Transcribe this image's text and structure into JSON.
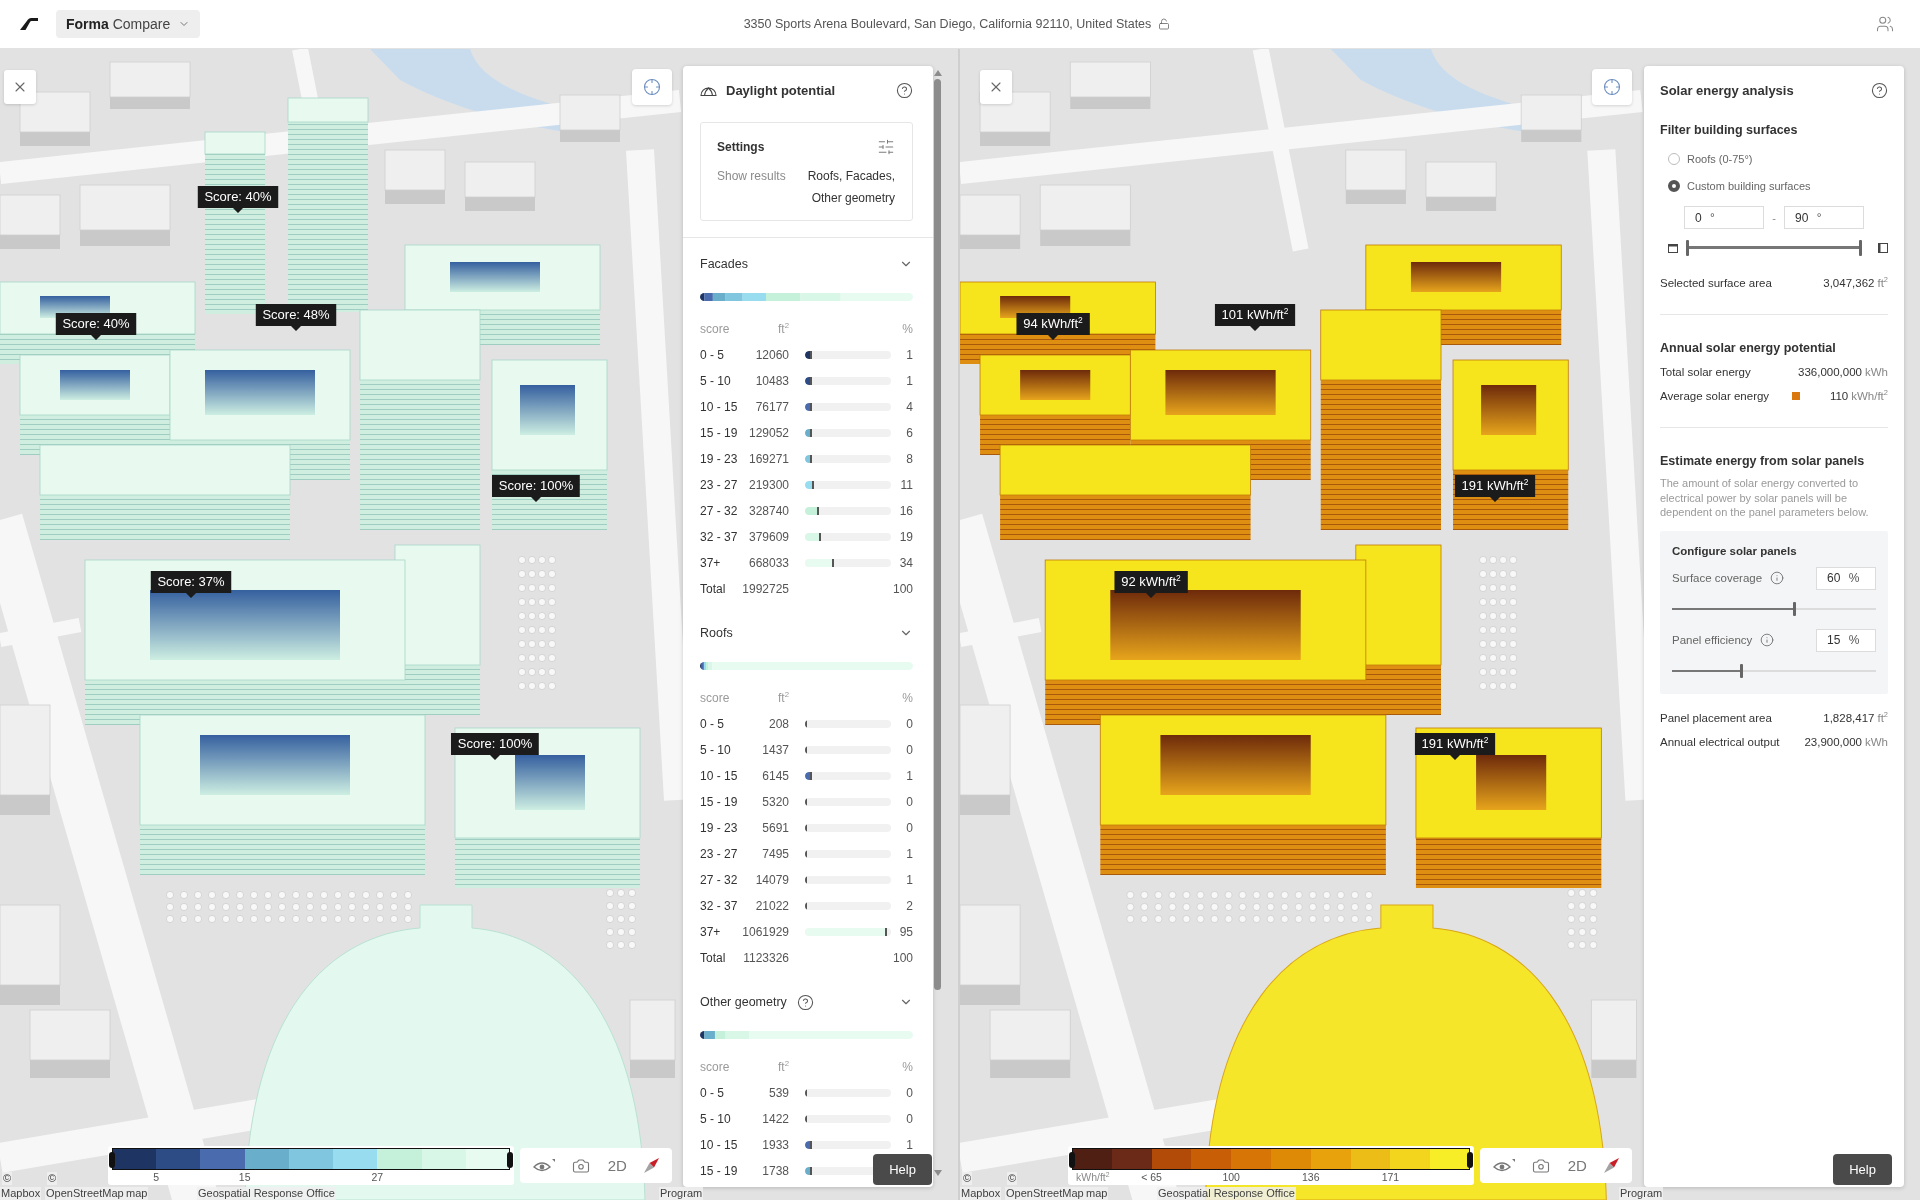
{
  "top_bar": {
    "app_switcher": "**Forma** Compare",
    "address": "3350 Sports Arena Boulevard, San Diego, California 92110, United States"
  },
  "views": [
    {
      "kind": "daylight",
      "map_labels": [
        "Score: 40%",
        "Score: 40%",
        "Score: 48%",
        "Score: 100%",
        "Score: 37%",
        "Score: 100%"
      ],
      "panel": {
        "title": "Daylight potential",
        "settings": {
          "title": "Settings",
          "label": "Show results",
          "value": "Roofs, Facades, Other geometry"
        },
        "sections": [
          {
            "title": "Facades",
            "expanded": true,
            "info_icon": false,
            "columns": [
              "score",
              "ft$^{2}$",
              "%"
            ],
            "rows": [
              {
                "score": "0 - 5",
                "area": "12060",
                "percent": "1",
                "level": 0.01,
                "color": "#1e3563"
              },
              {
                "score": "5 - 10",
                "area": "10483",
                "percent": "1",
                "level": 0.01,
                "color": "#2d4c86"
              },
              {
                "score": "10 - 15",
                "area": "76177",
                "percent": "4",
                "level": 0.04,
                "color": "#4a6cae"
              },
              {
                "score": "15 - 19",
                "area": "129052",
                "percent": "6",
                "level": 0.06,
                "color": "#69aecb"
              },
              {
                "score": "19 - 23",
                "area": "169271",
                "percent": "8",
                "level": 0.08,
                "color": "#7fc6de"
              },
              {
                "score": "23 - 27",
                "area": "219300",
                "percent": "11",
                "level": 0.11,
                "color": "#97dcef"
              },
              {
                "score": "27 - 32",
                "area": "328740",
                "percent": "16",
                "level": 0.16,
                "color": "#c5f1da"
              },
              {
                "score": "32 - 37",
                "area": "379609",
                "percent": "19",
                "level": 0.19,
                "color": "#d9f7e7"
              },
              {
                "score": "37+",
                "area": "668033",
                "percent": "34",
                "level": 0.34,
                "color": "#e8fbf1"
              }
            ],
            "total": {
              "label": "Total",
              "area": "1992725",
              "percent": "100"
            }
          },
          {
            "title": "Roofs",
            "expanded": true,
            "info_icon": false,
            "columns": [
              "score",
              "ft$^{2}$",
              "%"
            ],
            "rows": [
              {
                "score": "0 - 5",
                "area": "208",
                "percent": "0",
                "level": 0
              },
              {
                "score": "5 - 10",
                "area": "1437",
                "percent": "0",
                "level": 0
              },
              {
                "score": "10 - 15",
                "area": "6145",
                "percent": "1",
                "level": 0.01,
                "color": "#4a6cae"
              },
              {
                "score": "15 - 19",
                "area": "5320",
                "percent": "0",
                "level": 0
              },
              {
                "score": "19 - 23",
                "area": "5691",
                "percent": "0",
                "level": 0
              },
              {
                "score": "23 - 27",
                "area": "7495",
                "percent": "1",
                "level": 0.01
              },
              {
                "score": "27 - 32",
                "area": "14079",
                "percent": "1",
                "level": 0.01
              },
              {
                "score": "32 - 37",
                "area": "21022",
                "percent": "2",
                "level": 0.02
              },
              {
                "score": "37+",
                "area": "1061929",
                "percent": "95",
                "level": 0.95,
                "color": "#e8fbf1"
              }
            ],
            "total": {
              "label": "Total",
              "area": "1123326",
              "percent": "100"
            }
          },
          {
            "title": "Other geometry",
            "expanded": true,
            "info_icon": true,
            "columns": [
              "score",
              "ft$^{2}$",
              "%"
            ],
            "rows": [
              {
                "score": "0 - 5",
                "area": "539",
                "percent": "0",
                "level": 0
              },
              {
                "score": "5 - 10",
                "area": "1422",
                "percent": "0",
                "level": 0
              },
              {
                "score": "10 - 15",
                "area": "1933",
                "percent": "1",
                "level": 0.01,
                "color": "#4a6cae"
              },
              {
                "score": "15 - 19",
                "area": "1738",
                "level": 0.01,
                "color": "#69aecb"
              }
            ]
          }
        ]
      },
      "legend": {
        "segments": [
          {
            "color": "#1e3563"
          },
          {
            "color": "#2d4c86",
            "tick": "5"
          },
          {
            "color": "#4a6cae"
          },
          {
            "color": "#69aecb",
            "tick": "15"
          },
          {
            "color": "#7fc6de"
          },
          {
            "color": "#97dcef"
          },
          {
            "color": "#c5f1da",
            "tick": "27"
          },
          {
            "color": "#d9f7e7"
          },
          {
            "color": "#e8fbf1"
          }
        ]
      },
      "toolbar": {
        "mode": "2D"
      },
      "help": "Help",
      "attribution": [
        "©",
        "©",
        "Mapbox",
        "OpenStreetMap",
        "map",
        "Geospatial Response Office",
        "Program"
      ]
    },
    {
      "kind": "solar",
      "map_labels": [
        "94 kWh/ft$^{2}$",
        "101 kWh/ft$^{2}$",
        "191 kWh/ft$^{2}$",
        "92 kWh/ft$^{2}$",
        "191 kWh/ft$^{2}$"
      ],
      "panel": {
        "title": "Solar energy analysis",
        "filter": {
          "title": "Filter building surfaces",
          "options": [
            {
              "label": "Roofs (0-75°)",
              "selected": false
            },
            {
              "label": "Custom building surfaces",
              "selected": true
            }
          ],
          "range": {
            "from": {
              "value": "0",
              "unit": "°"
            },
            "separator": "-",
            "to": {
              "value": "90",
              "unit": "°"
            },
            "handles": [
              {
                "level": 0
              },
              {
                "level": 1
              }
            ]
          },
          "stats": [
            {
              "label": "Selected surface area",
              "value": "3,047,362",
              "unit": "ft$^{2}$"
            }
          ]
        },
        "potential": {
          "title": "Annual solar energy potential",
          "stats": [
            {
              "label": "Total solar energy",
              "value": "336,000,000",
              "unit": "kWh"
            },
            {
              "label": "Average solar energy",
              "value": "110",
              "unit": "kWh/ft$^{2}$",
              "color": "#d9780f"
            }
          ]
        },
        "estimate": {
          "title": "Estimate energy from solar panels",
          "description": "The amount of solar energy converted to electrical power by solar panels will be dependent on the panel parameters below.",
          "config": {
            "title": "Configure solar panels",
            "params": [
              {
                "label": "Surface coverage",
                "value": "60",
                "unit": "%",
                "level": 0.6
              },
              {
                "label": "Panel efficiency",
                "value": "15",
                "unit": "%",
                "level": 0.34
              }
            ]
          },
          "stats": [
            {
              "label": "Panel placement area",
              "value": "1,828,417",
              "unit": "ft$^{2}$"
            },
            {
              "label": "Annual electrical output",
              "value": "23,900,000",
              "unit": "kWh"
            }
          ]
        }
      },
      "legend": {
        "unit": "kWh/ft$^{2}$",
        "segments": [
          {
            "color": "#4e1f12"
          },
          {
            "color": "#6a2a17"
          },
          {
            "color": "#b24a08",
            "tick": "< 65"
          },
          {
            "color": "#c85f07"
          },
          {
            "color": "#d77607",
            "tick": "100"
          },
          {
            "color": "#de8a06"
          },
          {
            "color": "#e7a20c",
            "tick": "136"
          },
          {
            "color": "#ecbd16"
          },
          {
            "color": "#f2d51c",
            "tick": "171"
          },
          {
            "color": "#f8ee28"
          }
        ]
      },
      "toolbar": {
        "mode": "2D"
      },
      "help": "Help",
      "attribution": [
        "©",
        "©",
        "Mapbox",
        "OpenStreetMap",
        "map",
        "Geospatial Response Office",
        "Program"
      ]
    }
  ]
}
